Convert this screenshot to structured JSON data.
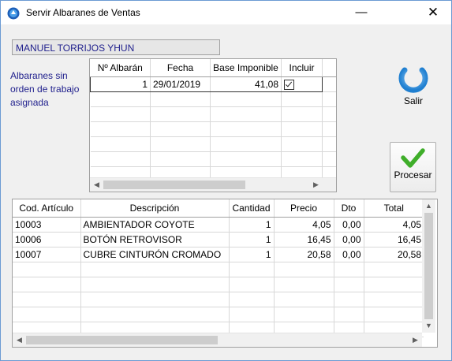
{
  "window": {
    "title": "Servir Albaranes de Ventas",
    "minimize_glyph": "—",
    "close_glyph": "✕"
  },
  "customer_name": "MANUEL TORRIJOS YHUN",
  "side_label": "Albaranes sin orden de trabajo asignada",
  "albaranes": {
    "columns": [
      "Nº Albarán",
      "Fecha",
      "Base Imponible",
      "Incluir"
    ],
    "rows": [
      {
        "numero": "1",
        "fecha": "29/01/2019",
        "base": "41,08",
        "incluir": true
      }
    ]
  },
  "buttons": {
    "salir": "Salir",
    "procesar": "Procesar"
  },
  "lines": {
    "columns": [
      "Cod. Artículo",
      "Descripción",
      "Cantidad",
      "Precio",
      "Dto",
      "Total"
    ],
    "rows": [
      {
        "cod": "10003",
        "desc": "AMBIENTADOR COYOTE",
        "cant": "1",
        "precio": "4,05",
        "dto": "0,00",
        "total": "4,05"
      },
      {
        "cod": "10006",
        "desc": "BOTÓN RETROVISOR",
        "cant": "1",
        "precio": "16,45",
        "dto": "0,00",
        "total": "16,45"
      },
      {
        "cod": "10007",
        "desc": "CUBRE CINTURÓN CROMADO",
        "cant": "1",
        "precio": "20,58",
        "dto": "0,00",
        "total": "20,58"
      }
    ]
  },
  "icons": {
    "app": "app-icon",
    "power": "power-icon",
    "check": "checkmark-icon"
  },
  "colors": {
    "label_text": "#1e1e8c",
    "power_blue": "#2a8fd8",
    "check_green": "#3fae2a"
  }
}
